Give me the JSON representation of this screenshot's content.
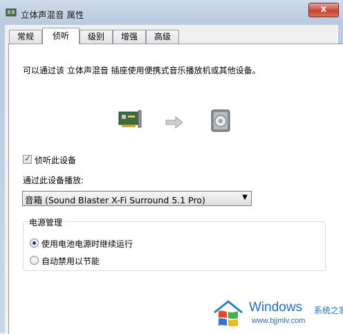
{
  "window": {
    "title": "立体声混音 属性",
    "close_label": "x"
  },
  "tabs": [
    {
      "label": "常规",
      "active": false
    },
    {
      "label": "侦听",
      "active": true
    },
    {
      "label": "级别",
      "active": false
    },
    {
      "label": "增强",
      "active": false
    },
    {
      "label": "高级",
      "active": false
    }
  ],
  "listen": {
    "description": "可以通过该 立体声混音 插座使用便携式音乐播放机或其他设备。",
    "icons": [
      "sound-card-icon",
      "arrow-right-icon",
      "speaker-icon"
    ],
    "checkbox_label": "侦听此设备",
    "checkbox_checked": true,
    "playback_label": "通过此设备播放:",
    "playback_value": "音箱 (Sound Blaster X-Fi Surround 5.1 Pro)"
  },
  "power": {
    "title": "电源管理",
    "options": [
      {
        "label": "使用电池电源时继续运行",
        "selected": true
      },
      {
        "label": "自动禁用以节能",
        "selected": false
      }
    ]
  },
  "watermark": {
    "brand": "Windows",
    "cn": "系统之家",
    "url": "www.bjjmlv.com"
  },
  "colors": {
    "accent": "#1d6fd1",
    "close": "#c7402f",
    "frame": "#c8d7e8"
  }
}
